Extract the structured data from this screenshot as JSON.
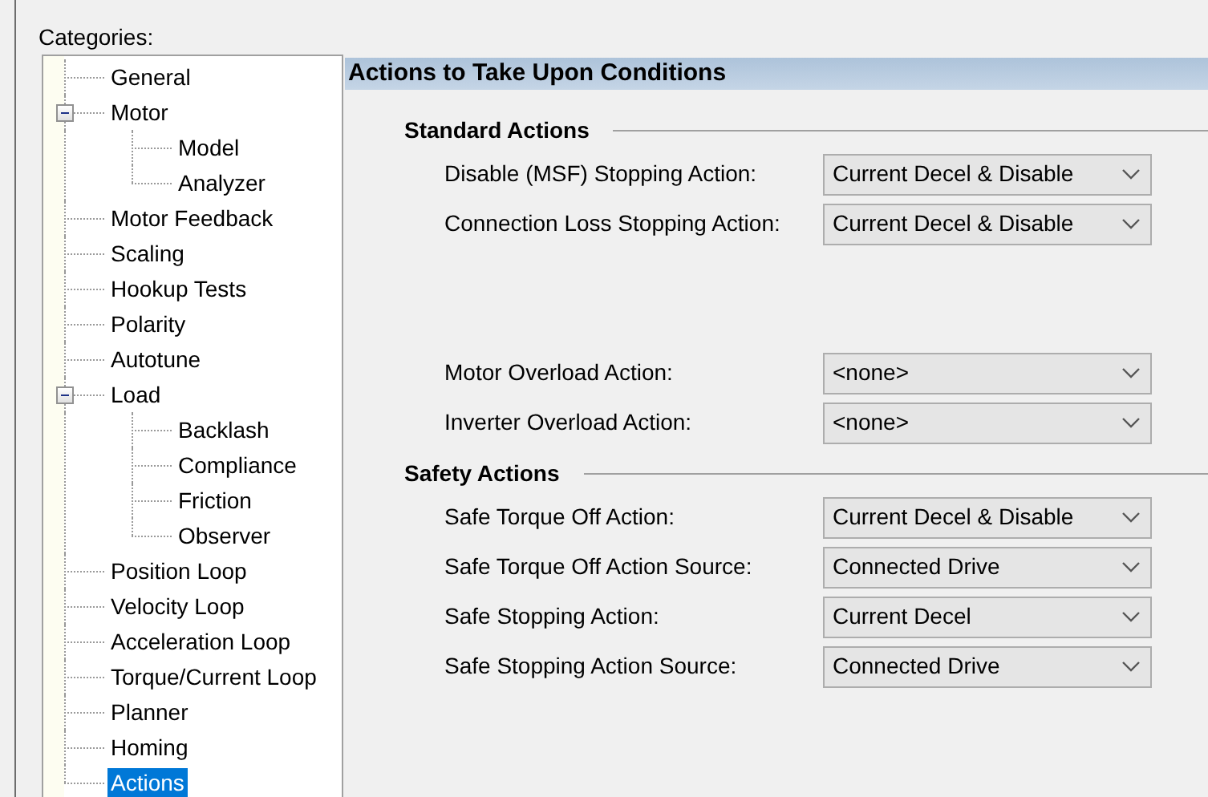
{
  "categories_label": "Categories:",
  "tree": [
    {
      "label": "General",
      "selected": false
    },
    {
      "label": "Motor",
      "selected": false,
      "expanded": true,
      "children": [
        {
          "label": "Model",
          "selected": false
        },
        {
          "label": "Analyzer",
          "selected": false
        }
      ]
    },
    {
      "label": "Motor Feedback",
      "selected": false
    },
    {
      "label": "Scaling",
      "selected": false
    },
    {
      "label": "Hookup Tests",
      "selected": false
    },
    {
      "label": "Polarity",
      "selected": false
    },
    {
      "label": "Autotune",
      "selected": false
    },
    {
      "label": "Load",
      "selected": false,
      "expanded": true,
      "children": [
        {
          "label": "Backlash",
          "selected": false
        },
        {
          "label": "Compliance",
          "selected": false
        },
        {
          "label": "Friction",
          "selected": false
        },
        {
          "label": "Observer",
          "selected": false
        }
      ]
    },
    {
      "label": "Position Loop",
      "selected": false
    },
    {
      "label": "Velocity Loop",
      "selected": false
    },
    {
      "label": "Acceleration Loop",
      "selected": false
    },
    {
      "label": "Torque/Current Loop",
      "selected": false
    },
    {
      "label": "Planner",
      "selected": false
    },
    {
      "label": "Homing",
      "selected": false
    },
    {
      "label": "Actions",
      "selected": true
    }
  ],
  "panel_title": "Actions to Take Upon Conditions",
  "sections": [
    {
      "title": "Standard Actions",
      "groups": [
        [
          {
            "label": "Disable (MSF) Stopping Action:",
            "value": "Current Decel & Disable"
          },
          {
            "label": "Connection Loss Stopping Action:",
            "value": "Current Decel & Disable"
          }
        ],
        [
          {
            "label": "Motor Overload Action:",
            "value": "<none>"
          },
          {
            "label": "Inverter Overload Action:",
            "value": "<none>"
          }
        ]
      ]
    },
    {
      "title": "Safety Actions",
      "groups": [
        [
          {
            "label": "Safe Torque Off Action:",
            "value": "Current Decel & Disable"
          },
          {
            "label": "Safe Torque Off Action Source:",
            "value": "Connected Drive"
          },
          {
            "label": "Safe Stopping Action:",
            "value": "Current Decel"
          },
          {
            "label": "Safe Stopping Action Source:",
            "value": "Connected Drive"
          }
        ]
      ]
    }
  ]
}
